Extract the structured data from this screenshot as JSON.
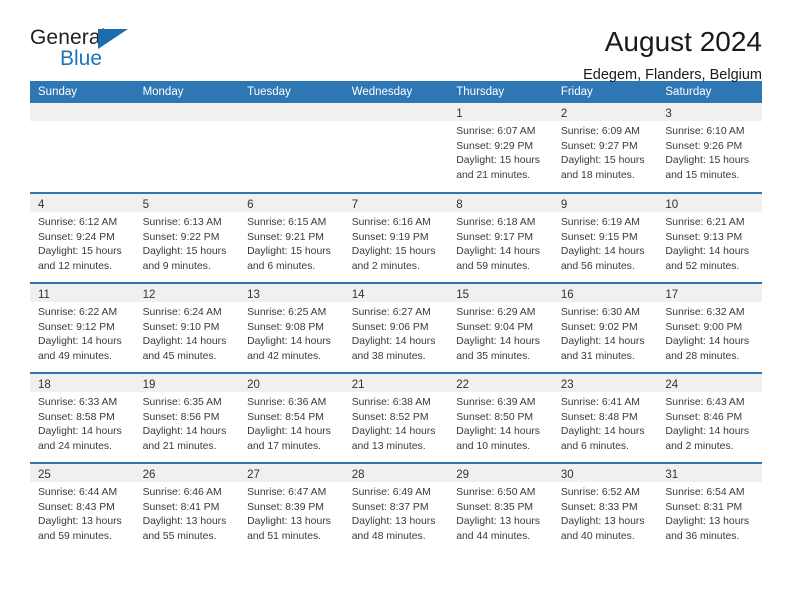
{
  "brand": {
    "word_one": "General",
    "word_two": "Blue",
    "triangle_icon": "blue-triangle-logo-icon"
  },
  "header": {
    "title": "August 2024",
    "location": "Edegem, Flanders, Belgium"
  },
  "colors": {
    "header_blue": "#2f76b5",
    "brand_blue": "#1b75bb",
    "daynum_band": "#f0f0f0",
    "text": "#3a3a3a"
  },
  "labels": {
    "sunrise_prefix": "Sunrise:",
    "sunset_prefix": "Sunset:",
    "daylight_prefix": "Daylight:"
  },
  "weekday_headers": [
    "Sunday",
    "Monday",
    "Tuesday",
    "Wednesday",
    "Thursday",
    "Friday",
    "Saturday"
  ],
  "weeks": [
    [
      {
        "day": "",
        "empty": true
      },
      {
        "day": "",
        "empty": true
      },
      {
        "day": "",
        "empty": true
      },
      {
        "day": "",
        "empty": true
      },
      {
        "day": "1",
        "sunrise": "Sunrise: 6:07 AM",
        "sunset": "Sunset: 9:29 PM",
        "daylight_1": "Daylight: 15 hours",
        "daylight_2": "and 21 minutes."
      },
      {
        "day": "2",
        "sunrise": "Sunrise: 6:09 AM",
        "sunset": "Sunset: 9:27 PM",
        "daylight_1": "Daylight: 15 hours",
        "daylight_2": "and 18 minutes."
      },
      {
        "day": "3",
        "sunrise": "Sunrise: 6:10 AM",
        "sunset": "Sunset: 9:26 PM",
        "daylight_1": "Daylight: 15 hours",
        "daylight_2": "and 15 minutes."
      }
    ],
    [
      {
        "day": "4",
        "sunrise": "Sunrise: 6:12 AM",
        "sunset": "Sunset: 9:24 PM",
        "daylight_1": "Daylight: 15 hours",
        "daylight_2": "and 12 minutes."
      },
      {
        "day": "5",
        "sunrise": "Sunrise: 6:13 AM",
        "sunset": "Sunset: 9:22 PM",
        "daylight_1": "Daylight: 15 hours",
        "daylight_2": "and 9 minutes."
      },
      {
        "day": "6",
        "sunrise": "Sunrise: 6:15 AM",
        "sunset": "Sunset: 9:21 PM",
        "daylight_1": "Daylight: 15 hours",
        "daylight_2": "and 6 minutes."
      },
      {
        "day": "7",
        "sunrise": "Sunrise: 6:16 AM",
        "sunset": "Sunset: 9:19 PM",
        "daylight_1": "Daylight: 15 hours",
        "daylight_2": "and 2 minutes."
      },
      {
        "day": "8",
        "sunrise": "Sunrise: 6:18 AM",
        "sunset": "Sunset: 9:17 PM",
        "daylight_1": "Daylight: 14 hours",
        "daylight_2": "and 59 minutes."
      },
      {
        "day": "9",
        "sunrise": "Sunrise: 6:19 AM",
        "sunset": "Sunset: 9:15 PM",
        "daylight_1": "Daylight: 14 hours",
        "daylight_2": "and 56 minutes."
      },
      {
        "day": "10",
        "sunrise": "Sunrise: 6:21 AM",
        "sunset": "Sunset: 9:13 PM",
        "daylight_1": "Daylight: 14 hours",
        "daylight_2": "and 52 minutes."
      }
    ],
    [
      {
        "day": "11",
        "sunrise": "Sunrise: 6:22 AM",
        "sunset": "Sunset: 9:12 PM",
        "daylight_1": "Daylight: 14 hours",
        "daylight_2": "and 49 minutes."
      },
      {
        "day": "12",
        "sunrise": "Sunrise: 6:24 AM",
        "sunset": "Sunset: 9:10 PM",
        "daylight_1": "Daylight: 14 hours",
        "daylight_2": "and 45 minutes."
      },
      {
        "day": "13",
        "sunrise": "Sunrise: 6:25 AM",
        "sunset": "Sunset: 9:08 PM",
        "daylight_1": "Daylight: 14 hours",
        "daylight_2": "and 42 minutes."
      },
      {
        "day": "14",
        "sunrise": "Sunrise: 6:27 AM",
        "sunset": "Sunset: 9:06 PM",
        "daylight_1": "Daylight: 14 hours",
        "daylight_2": "and 38 minutes."
      },
      {
        "day": "15",
        "sunrise": "Sunrise: 6:29 AM",
        "sunset": "Sunset: 9:04 PM",
        "daylight_1": "Daylight: 14 hours",
        "daylight_2": "and 35 minutes."
      },
      {
        "day": "16",
        "sunrise": "Sunrise: 6:30 AM",
        "sunset": "Sunset: 9:02 PM",
        "daylight_1": "Daylight: 14 hours",
        "daylight_2": "and 31 minutes."
      },
      {
        "day": "17",
        "sunrise": "Sunrise: 6:32 AM",
        "sunset": "Sunset: 9:00 PM",
        "daylight_1": "Daylight: 14 hours",
        "daylight_2": "and 28 minutes."
      }
    ],
    [
      {
        "day": "18",
        "sunrise": "Sunrise: 6:33 AM",
        "sunset": "Sunset: 8:58 PM",
        "daylight_1": "Daylight: 14 hours",
        "daylight_2": "and 24 minutes."
      },
      {
        "day": "19",
        "sunrise": "Sunrise: 6:35 AM",
        "sunset": "Sunset: 8:56 PM",
        "daylight_1": "Daylight: 14 hours",
        "daylight_2": "and 21 minutes."
      },
      {
        "day": "20",
        "sunrise": "Sunrise: 6:36 AM",
        "sunset": "Sunset: 8:54 PM",
        "daylight_1": "Daylight: 14 hours",
        "daylight_2": "and 17 minutes."
      },
      {
        "day": "21",
        "sunrise": "Sunrise: 6:38 AM",
        "sunset": "Sunset: 8:52 PM",
        "daylight_1": "Daylight: 14 hours",
        "daylight_2": "and 13 minutes."
      },
      {
        "day": "22",
        "sunrise": "Sunrise: 6:39 AM",
        "sunset": "Sunset: 8:50 PM",
        "daylight_1": "Daylight: 14 hours",
        "daylight_2": "and 10 minutes."
      },
      {
        "day": "23",
        "sunrise": "Sunrise: 6:41 AM",
        "sunset": "Sunset: 8:48 PM",
        "daylight_1": "Daylight: 14 hours",
        "daylight_2": "and 6 minutes."
      },
      {
        "day": "24",
        "sunrise": "Sunrise: 6:43 AM",
        "sunset": "Sunset: 8:46 PM",
        "daylight_1": "Daylight: 14 hours",
        "daylight_2": "and 2 minutes."
      }
    ],
    [
      {
        "day": "25",
        "sunrise": "Sunrise: 6:44 AM",
        "sunset": "Sunset: 8:43 PM",
        "daylight_1": "Daylight: 13 hours",
        "daylight_2": "and 59 minutes."
      },
      {
        "day": "26",
        "sunrise": "Sunrise: 6:46 AM",
        "sunset": "Sunset: 8:41 PM",
        "daylight_1": "Daylight: 13 hours",
        "daylight_2": "and 55 minutes."
      },
      {
        "day": "27",
        "sunrise": "Sunrise: 6:47 AM",
        "sunset": "Sunset: 8:39 PM",
        "daylight_1": "Daylight: 13 hours",
        "daylight_2": "and 51 minutes."
      },
      {
        "day": "28",
        "sunrise": "Sunrise: 6:49 AM",
        "sunset": "Sunset: 8:37 PM",
        "daylight_1": "Daylight: 13 hours",
        "daylight_2": "and 48 minutes."
      },
      {
        "day": "29",
        "sunrise": "Sunrise: 6:50 AM",
        "sunset": "Sunset: 8:35 PM",
        "daylight_1": "Daylight: 13 hours",
        "daylight_2": "and 44 minutes."
      },
      {
        "day": "30",
        "sunrise": "Sunrise: 6:52 AM",
        "sunset": "Sunset: 8:33 PM",
        "daylight_1": "Daylight: 13 hours",
        "daylight_2": "and 40 minutes."
      },
      {
        "day": "31",
        "sunrise": "Sunrise: 6:54 AM",
        "sunset": "Sunset: 8:31 PM",
        "daylight_1": "Daylight: 13 hours",
        "daylight_2": "and 36 minutes."
      }
    ]
  ]
}
